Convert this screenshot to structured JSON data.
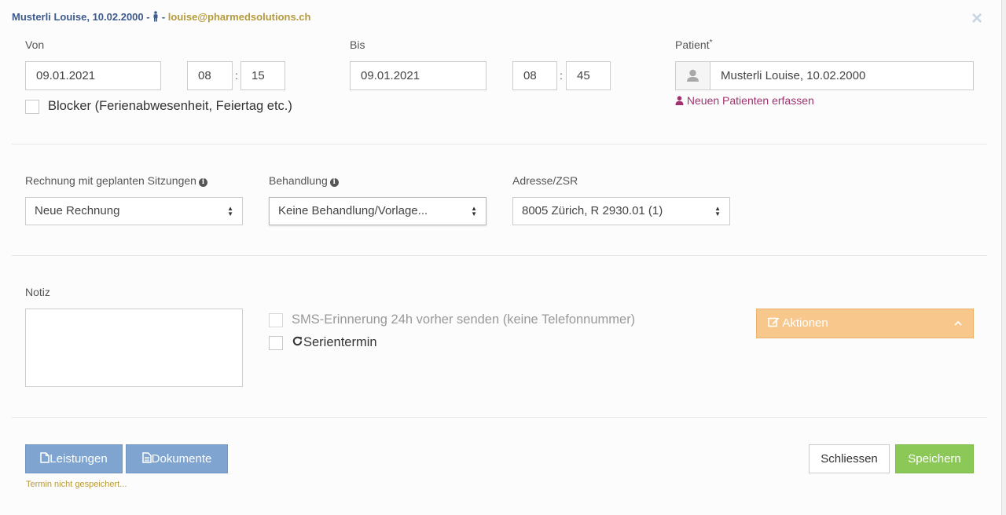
{
  "header": {
    "patient_name": "Musterli Louise, 10.02.2000",
    "separator_1": " - ",
    "separator_2": " - ",
    "email": "louise@pharmedsolutions.ch",
    "gender_icon": "male-icon",
    "close_glyph": "×"
  },
  "von": {
    "label": "Von",
    "date": "09.01.2021",
    "hour": "08",
    "minute": "15",
    "colon": ":"
  },
  "bis": {
    "label": "Bis",
    "date": "09.01.2021",
    "hour": "08",
    "minute": "45",
    "colon": ":"
  },
  "patient": {
    "label": "Patient",
    "required_mark": "*",
    "value": "Musterli Louise, 10.02.2000",
    "new_patient_link": "Neuen Patienten erfassen",
    "icon": "user-icon"
  },
  "blocker": {
    "label": "Blocker (Ferienabwesenheit, Feiertag etc.)",
    "checked": false
  },
  "rechnung": {
    "label": "Rechnung mit geplanten Sitzungen",
    "selected": "Neue Rechnung"
  },
  "behandlung": {
    "label": "Behandlung",
    "selected": "Keine Behandlung/Vorlage..."
  },
  "adresse": {
    "label": "Adresse/ZSR",
    "selected": "8005 Zürich, R 2930.01 (1)"
  },
  "notiz": {
    "label": "Notiz",
    "value": ""
  },
  "sms": {
    "label": "SMS-Erinnerung 24h vorher senden (keine Telefonnummer)",
    "checked": false,
    "disabled": true
  },
  "serie": {
    "label": "Serientermin",
    "checked": false,
    "icon": "refresh-icon"
  },
  "actions": {
    "label": "Aktionen",
    "icon": "edit-icon",
    "chevron": "chevron-up-icon"
  },
  "footer": {
    "leistungen": "Leistungen",
    "dokumente": "Dokumente",
    "close": "Schliessen",
    "save": "Speichern",
    "status": "Termin nicht gespeichert..."
  },
  "colors": {
    "header_name": "#3d5a8c",
    "email": "#b59a3b",
    "link": "#a0336f",
    "actions_bg": "#f7c78c",
    "button_blue": "#7ea4cf",
    "button_green": "#8bc857"
  }
}
